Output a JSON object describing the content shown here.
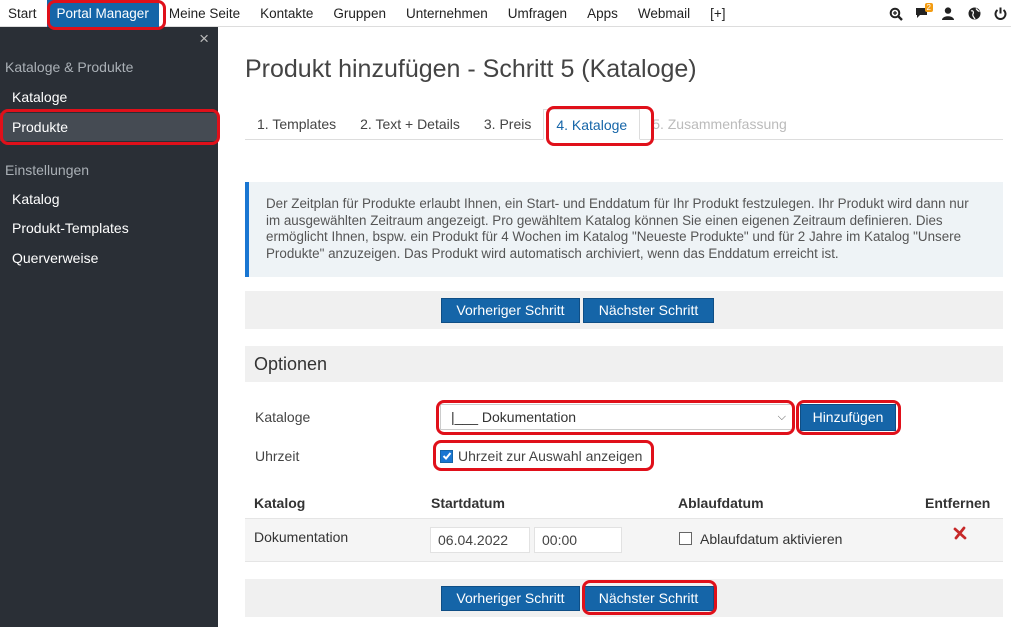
{
  "topnav": {
    "items": [
      "Start",
      "Portal Manager",
      "Meine Seite",
      "Kontakte",
      "Gruppen",
      "Unternehmen",
      "Umfragen",
      "Apps",
      "Webmail",
      "[+]"
    ],
    "active_index": 1,
    "icons": [
      "search-zoom-icon",
      "chat-icon",
      "user-icon",
      "globe-icon",
      "power-icon"
    ],
    "chat_badge": "2"
  },
  "sidebar": {
    "close": "×",
    "section1": "Kataloge & Produkte",
    "items1": [
      "Kataloge",
      "Produkte"
    ],
    "section2": "Einstellungen",
    "items2": [
      "Katalog",
      "Produkt-Templates",
      "Querverweise"
    ]
  },
  "main": {
    "title": "Produkt hinzufügen - Schritt 5 (Kataloge)",
    "tabs": [
      "1. Templates",
      "2. Text + Details",
      "3. Preis",
      "4. Kataloge",
      "5. Zusammenfassung"
    ],
    "info": "Der Zeitplan für Produkte erlaubt Ihnen, ein Start- und Enddatum für Ihr Produkt festzulegen. Ihr Produkt wird dann nur im ausgewählten Zeitraum angezeigt. Pro gewähltem Katalog können Sie einen eigenen Zeitraum definieren. Dies ermöglicht Ihnen, bspw. ein Produkt für 4 Wochen im Katalog \"Neueste Produkte\" und für 2 Jahre im Katalog \"Unsere Produkte\" anzuzeigen. Das Produkt wird automatisch archiviert, wenn das Enddatum erreicht ist.",
    "prev_label": "Vorheriger Schritt",
    "next_label": "Nächster Schritt",
    "options_title": "Optionen",
    "catalog_label": "Kataloge",
    "catalog_selected": "|___ Dokumentation",
    "add_label": "Hinzufügen",
    "time_label": "Uhrzeit",
    "time_checkbox_label": "Uhrzeit zur Auswahl anzeigen",
    "time_checked": true
  },
  "table": {
    "headers": [
      "Katalog",
      "Startdatum",
      "Ablaufdatum",
      "Entfernen"
    ],
    "rows": [
      {
        "catalog": "Dokumentation",
        "start_date": "06.04.2022",
        "start_time": "00:00",
        "expiry_label": "Ablaufdatum aktivieren",
        "expiry_checked": false,
        "remove_icon": "red-x-icon"
      }
    ]
  },
  "colors": {
    "primary": "#1565a8",
    "sidebar_bg": "#2a2f36",
    "info_border": "#1976d2",
    "highlight": "#e0101a",
    "remove": "#c62828",
    "badge": "#f39c12"
  }
}
